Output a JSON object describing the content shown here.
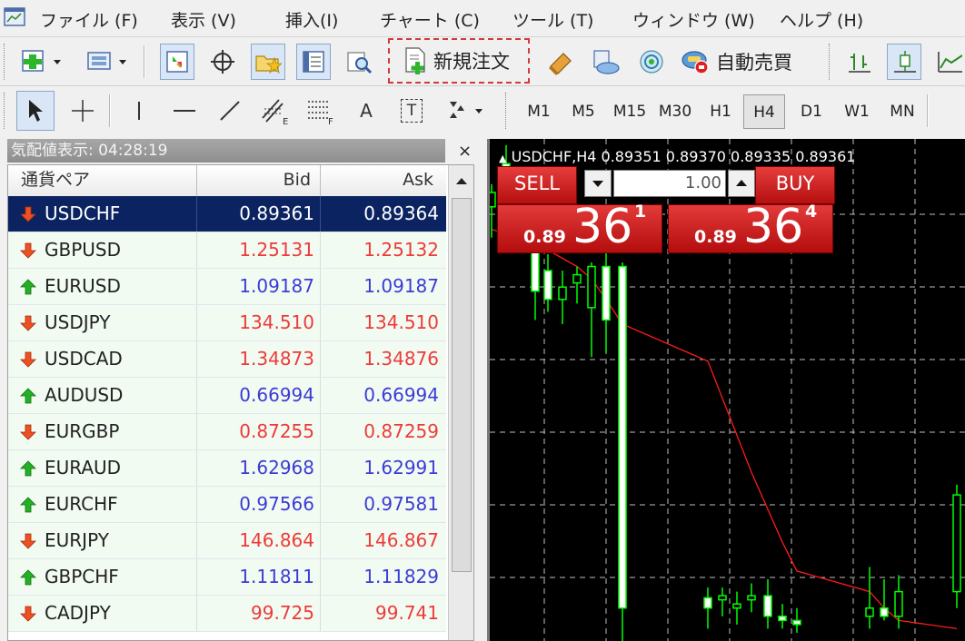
{
  "menubar": {
    "items": [
      {
        "label": "ファイル (F)"
      },
      {
        "label": "表示 (V)"
      },
      {
        "label": "挿入(I)"
      },
      {
        "label": "チャート (C)"
      },
      {
        "label": "ツール (T)"
      },
      {
        "label": "ウィンドウ (W)"
      },
      {
        "label": "ヘルプ (H)"
      }
    ]
  },
  "toolbar": {
    "new_order_label": "新規注文",
    "auto_trade_label": "自動売買",
    "text_tool_label": "A",
    "text_label_tool_label": "T"
  },
  "timeframes": [
    "M1",
    "M5",
    "M15",
    "M30",
    "H1",
    "H4",
    "D1",
    "W1",
    "MN"
  ],
  "active_timeframe": "H4",
  "market_watch": {
    "title": "気配値表示: 04:28:19",
    "columns": {
      "pair": "通貨ペア",
      "bid": "Bid",
      "ask": "Ask"
    },
    "rows": [
      {
        "symbol": "USDCHF",
        "bid": "0.89361",
        "ask": "0.89364",
        "direction": "down",
        "selected": true
      },
      {
        "symbol": "GBPUSD",
        "bid": "1.25131",
        "ask": "1.25132",
        "direction": "down"
      },
      {
        "symbol": "EURUSD",
        "bid": "1.09187",
        "ask": "1.09187",
        "direction": "up"
      },
      {
        "symbol": "USDJPY",
        "bid": "134.510",
        "ask": "134.510",
        "direction": "down"
      },
      {
        "symbol": "USDCAD",
        "bid": "1.34873",
        "ask": "1.34876",
        "direction": "down"
      },
      {
        "symbol": "AUDUSD",
        "bid": "0.66994",
        "ask": "0.66994",
        "direction": "up"
      },
      {
        "symbol": "EURGBP",
        "bid": "0.87255",
        "ask": "0.87259",
        "direction": "down"
      },
      {
        "symbol": "EURAUD",
        "bid": "1.62968",
        "ask": "1.62991",
        "direction": "up"
      },
      {
        "symbol": "EURCHF",
        "bid": "0.97566",
        "ask": "0.97581",
        "direction": "up"
      },
      {
        "symbol": "EURJPY",
        "bid": "146.864",
        "ask": "146.867",
        "direction": "down"
      },
      {
        "symbol": "GBPCHF",
        "bid": "1.11811",
        "ask": "1.11829",
        "direction": "up"
      },
      {
        "symbol": "CADJPY",
        "bid": "99.725",
        "ask": "99.741",
        "direction": "down"
      }
    ],
    "colors": {
      "up": "#3b3bd6",
      "down": "#ee3a3a",
      "selected_bg": "#0b2461",
      "row_bg": "#f1fbf1"
    }
  },
  "chart": {
    "info": "USDCHF,H4  0.89351 0.89370 0.89335 0.89361",
    "sell_label": "SELL",
    "buy_label": "BUY",
    "sell_price": {
      "prefix": "0.89",
      "big": "36",
      "sup": "1"
    },
    "buy_price": {
      "prefix": "0.89",
      "big": "36",
      "sup": "4"
    },
    "lot": "1.00",
    "candle_color": "#00ff00",
    "ma_color": "#ff1a1a",
    "grid_color": "#bfbfbf",
    "candles": [
      {
        "o": 0.8935,
        "h": 0.8946,
        "l": 0.892,
        "c": 0.8942
      },
      {
        "o": 0.8956,
        "h": 0.8965,
        "l": 0.895,
        "c": 0.8952
      },
      {
        "o": 0.895,
        "h": 0.8952,
        "l": 0.8918,
        "c": 0.8922
      },
      {
        "o": 0.8924,
        "h": 0.8926,
        "l": 0.888,
        "c": 0.8894
      },
      {
        "o": 0.8904,
        "h": 0.8912,
        "l": 0.8884,
        "c": 0.889
      },
      {
        "o": 0.889,
        "h": 0.8904,
        "l": 0.8878,
        "c": 0.8896
      },
      {
        "o": 0.8898,
        "h": 0.8906,
        "l": 0.8888,
        "c": 0.8902
      },
      {
        "o": 0.8886,
        "h": 0.8908,
        "l": 0.8862,
        "c": 0.8906
      },
      {
        "o": 0.8906,
        "h": 0.8914,
        "l": 0.8864,
        "c": 0.888
      },
      {
        "o": 0.8906,
        "h": 0.8908,
        "l": 0.872,
        "c": 0.874
      },
      {
        "o": 0.8745,
        "h": 0.875,
        "l": 0.873,
        "c": 0.874
      },
      {
        "o": 0.8744,
        "h": 0.875,
        "l": 0.8736,
        "c": 0.8746
      },
      {
        "o": 0.874,
        "h": 0.8748,
        "l": 0.8732,
        "c": 0.8742
      },
      {
        "o": 0.8744,
        "h": 0.8752,
        "l": 0.8738,
        "c": 0.8746
      },
      {
        "o": 0.8746,
        "h": 0.8754,
        "l": 0.873,
        "c": 0.8736
      },
      {
        "o": 0.8736,
        "h": 0.8742,
        "l": 0.873,
        "c": 0.8734
      },
      {
        "o": 0.8734,
        "h": 0.874,
        "l": 0.8728,
        "c": 0.8732
      },
      {
        "o": 0.8736,
        "h": 0.876,
        "l": 0.873,
        "c": 0.874
      },
      {
        "o": 0.874,
        "h": 0.8754,
        "l": 0.8734,
        "c": 0.8736
      },
      {
        "o": 0.8736,
        "h": 0.8756,
        "l": 0.873,
        "c": 0.8748
      },
      {
        "o": 0.8748,
        "h": 0.88,
        "l": 0.874,
        "c": 0.8795
      }
    ],
    "ma": [
      0.8924,
      0.8922,
      0.892,
      0.8917,
      0.8914,
      0.891,
      0.8906,
      0.89,
      0.889,
      0.8878,
      0.886,
      0.8842,
      0.8824,
      0.8806,
      0.8788,
      0.8772,
      0.8758,
      0.8748,
      0.874,
      0.8734,
      0.873
    ]
  }
}
